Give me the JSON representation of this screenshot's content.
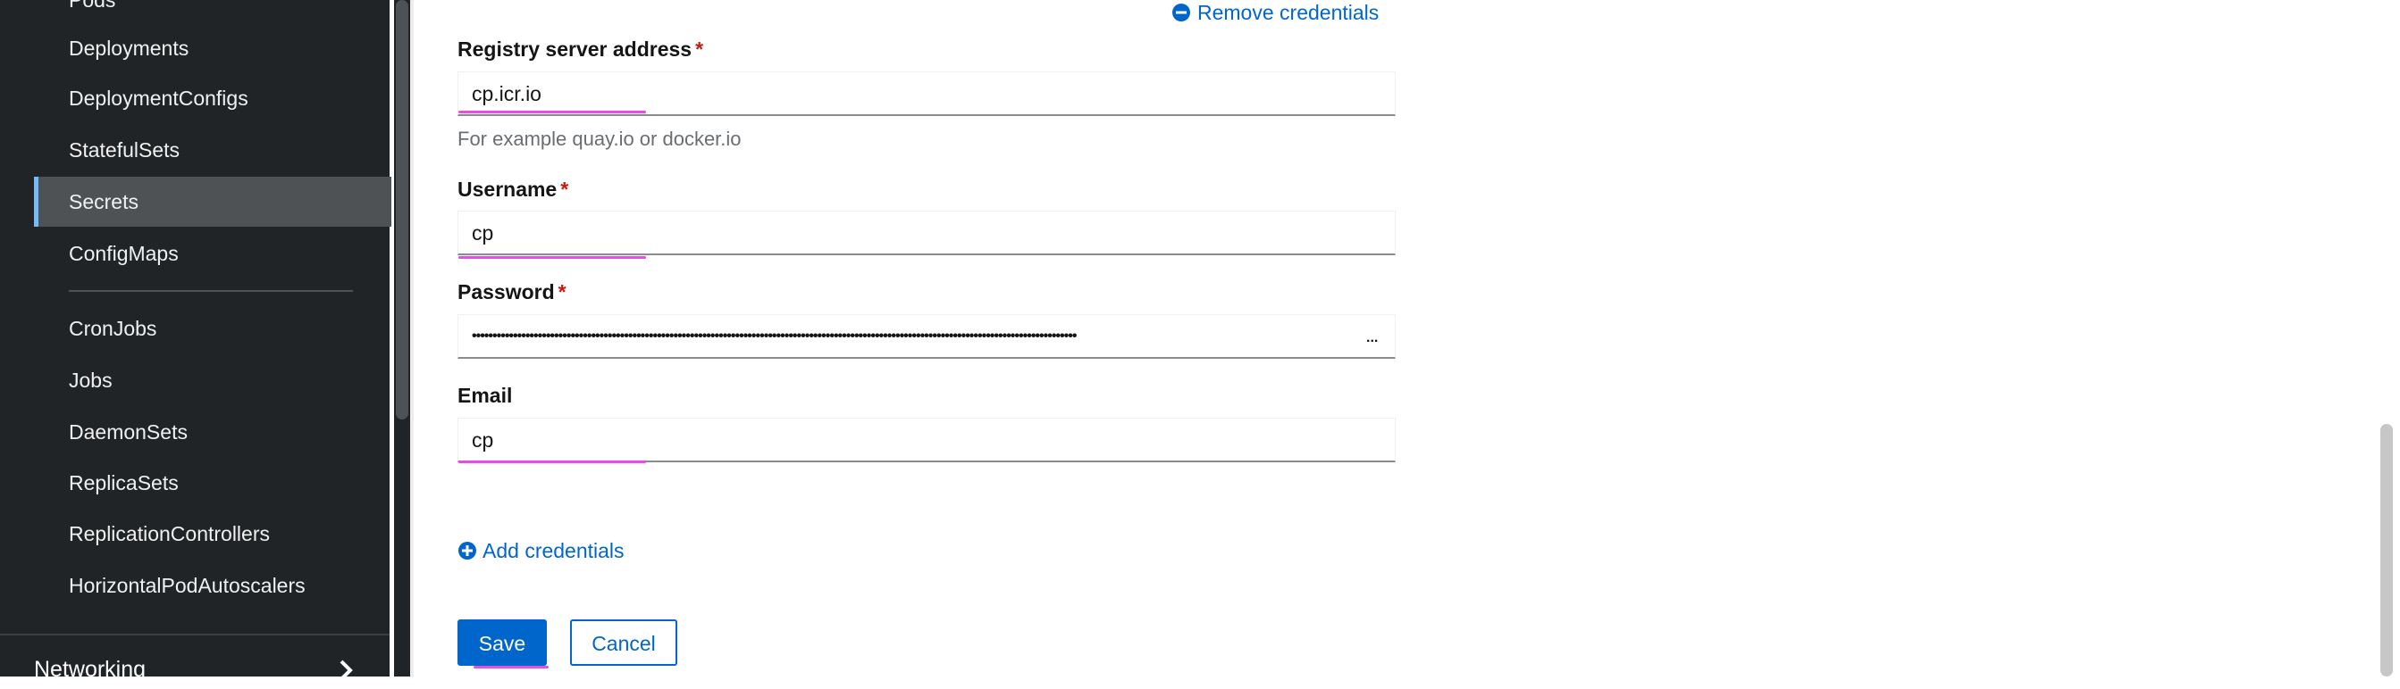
{
  "sidebar": {
    "items": [
      {
        "label": "Pods"
      },
      {
        "label": "Deployments"
      },
      {
        "label": "DeploymentConfigs"
      },
      {
        "label": "StatefulSets"
      },
      {
        "label": "Secrets",
        "active": true
      },
      {
        "label": "ConfigMaps"
      },
      {
        "label": "CronJobs"
      },
      {
        "label": "Jobs"
      },
      {
        "label": "DaemonSets"
      },
      {
        "label": "ReplicaSets"
      },
      {
        "label": "ReplicationControllers"
      },
      {
        "label": "HorizontalPodAutoscalers"
      }
    ],
    "section_label": "Networking",
    "section_icon": "chevron-right-icon"
  },
  "form": {
    "remove_credentials_label": "Remove credentials",
    "remove_icon": "minus-circle-icon",
    "registry": {
      "label": "Registry server address",
      "required_mark": "*",
      "value": "cp.icr.io",
      "helper": "For example quay.io or docker.io"
    },
    "username": {
      "label": "Username",
      "required_mark": "*",
      "value": "cp"
    },
    "password": {
      "label": "Password",
      "required_mark": "*",
      "value": "•••••••••••••••••••••••••••••••••••••••••••••••••••••••••••••••••••••••••••••••••••••••••••••••••••••••••••••••••••••••••••••••••••••••••••••••••••",
      "overflow_mark": "..."
    },
    "email": {
      "label": "Email",
      "value": "cp"
    },
    "add_credentials_label": "Add credentials",
    "add_icon": "plus-circle-icon",
    "save_label": "Save",
    "cancel_label": "Cancel"
  },
  "colors": {
    "sidebar_bg": "#212427",
    "active_item_bg": "#4f5255",
    "active_indicator": "#73bcf7",
    "link": "#0066cc",
    "required": "#c9190b",
    "annotation_mark": "#e44ee6"
  }
}
